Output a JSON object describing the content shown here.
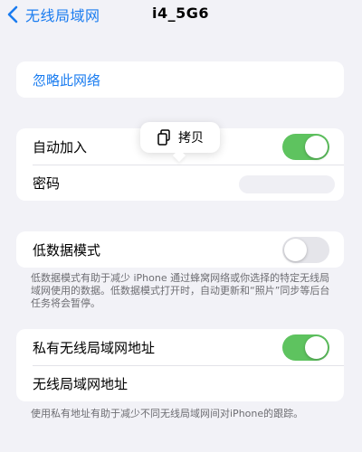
{
  "nav": {
    "back_label": "无线局域网",
    "title": "i4_5G6"
  },
  "forget": {
    "label": "忽略此网络"
  },
  "network": {
    "auto_join_label": "自动加入",
    "auto_join_on": true,
    "password_label": "密码"
  },
  "popup": {
    "copy_label": "拷贝"
  },
  "low_data": {
    "label": "低数据模式",
    "on": false,
    "footnote": "低数据模式有助于减少 iPhone 通过蜂窝网络或你选择的特定无线局域网使用的数据。低数据模式打开时，自动更新和“照片”同步等后台任务将会暂停。"
  },
  "private_address": {
    "label": "私有无线局域网地址",
    "on": true,
    "address_label": "无线局域网地址",
    "footnote": "使用私有地址有助于减少不同无线局域网间对iPhone的跟踪。"
  },
  "colors": {
    "accent": "#1a7cf0",
    "toggle_on": "#5ec35f",
    "background": "#f2f2f7"
  }
}
